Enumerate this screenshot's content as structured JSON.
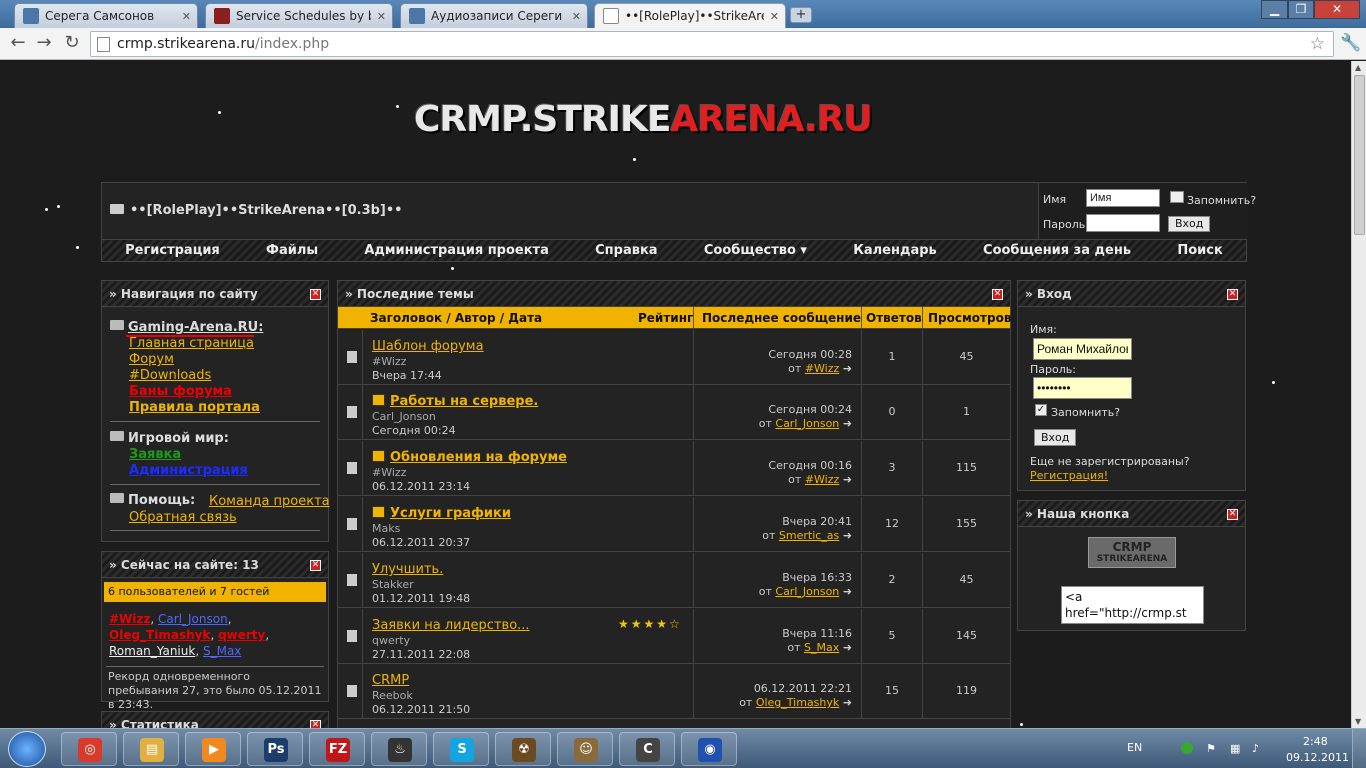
{
  "browser": {
    "tabs": [
      {
        "title": "Серега Самсонов",
        "icon": "vk-icon",
        "color": "#4a76a8"
      },
      {
        "title": "Service Schedules by break",
        "icon": "sa-icon",
        "color": "#8a2020"
      },
      {
        "title": "Аудиозаписи Сереги Самс",
        "icon": "vk-icon",
        "color": "#4a76a8"
      },
      {
        "title": "••[RolePlay]••StrikeArena••[",
        "icon": "page-icon",
        "color": "#ffffff"
      }
    ],
    "url_host": "crmp.strikearena.ru",
    "url_path": "/index.php"
  },
  "site": {
    "logo_main": "CRMP.STRIKE",
    "logo_red": "ARENA",
    "logo_end": ".RU",
    "title": "••[RolePlay]••StrikeArena••[0.3b]••",
    "header_login": {
      "name_label": "Имя",
      "name_value": "Имя",
      "remember": "Запомнить?",
      "pass_label": "Пароль",
      "login_btn": "Вход"
    },
    "menu": [
      "Регистрация",
      "Файлы",
      "Администрация проекта",
      "Справка",
      "Сообщество ▾",
      "Календарь",
      "Сообщения за день",
      "Поиск"
    ]
  },
  "nav": {
    "title": "» Навигация по сайту",
    "site_name": "Gaming-Arena.RU:",
    "links": [
      "Главная страница",
      "Форум",
      "#Downloads"
    ],
    "bans": "Баны форума",
    "rules": "Правила портала",
    "game_world": "Игровой мир:",
    "apply": "Заявка",
    "admin": "Администрация",
    "help": "Помощь:",
    "team": "Команда проекта",
    "feedback": "Обратная связь"
  },
  "online": {
    "title": "» Сейчас на сайте: 13",
    "bar": "6 пользователей и 7 гостей",
    "users_line1": [
      "#Wizz",
      "Carl_Jonson"
    ],
    "users_line2": [
      "Oleg_Timashyk",
      "qwerty"
    ],
    "users_line3": [
      "Roman_Yaniuk",
      "S_Max"
    ],
    "record": "Рекорд одновременного пребывания 27, это было 05.12.2011 в 23:43."
  },
  "stats": {
    "title": "» Статистика"
  },
  "topics": {
    "title": "» Последние темы",
    "headers": {
      "title": "Заголовок / Автор / Дата",
      "rating": "Рейтинг",
      "last": "Последнее сообщение",
      "replies": "Ответов",
      "views": "Просмотров"
    },
    "rows": [
      {
        "icon": "chart-icon",
        "title": "Шаблон форума",
        "bold": false,
        "hot": false,
        "author": "#Wizz",
        "date_day": "Вчера",
        "date_time": "17:44",
        "lp_day": "Сегодня",
        "lp_time": "00:28",
        "lp_from": "от",
        "lp_user": "#Wizz",
        "replies": "1",
        "views": "45",
        "stars": ""
      },
      {
        "icon": "bulb-icon",
        "title": "Работы на сервере.",
        "bold": true,
        "hot": true,
        "author": "Carl_Jonson",
        "date_day": "Сегодня",
        "date_time": "00:24",
        "lp_day": "Сегодня",
        "lp_time": "00:24",
        "lp_from": "от",
        "lp_user": "Carl_Jonson",
        "replies": "0",
        "views": "1",
        "stars": ""
      },
      {
        "icon": "doc-icon",
        "title": "Обновления на форуме",
        "bold": true,
        "hot": true,
        "author": "#Wizz",
        "date_day": "06.12.2011",
        "date_time": "23:14",
        "lp_day": "Сегодня",
        "lp_time": "00:16",
        "lp_from": "от",
        "lp_user": "#Wizz",
        "replies": "3",
        "views": "115",
        "stars": ""
      },
      {
        "icon": "doc-icon",
        "title": "Услуги графики",
        "bold": true,
        "hot": true,
        "author": "Maks",
        "date_day": "06.12.2011",
        "date_time": "20:37",
        "lp_day": "Вчера",
        "lp_time": "20:41",
        "lp_from": "от",
        "lp_user": "Smertic_as",
        "replies": "12",
        "views": "155",
        "stars": ""
      },
      {
        "icon": "bulb-icon",
        "title": "Улучшить.",
        "bold": false,
        "hot": false,
        "author": "Stakker",
        "date_day": "01.12.2011",
        "date_time": "19:48",
        "lp_day": "Вчера",
        "lp_time": "16:33",
        "lp_from": "от",
        "lp_user": "Carl_Jonson",
        "replies": "2",
        "views": "45",
        "stars": ""
      },
      {
        "icon": "doc-icon",
        "title": "Заявки на лидерство...",
        "bold": false,
        "hot": false,
        "author": "qwerty",
        "date_day": "27.11.2011",
        "date_time": "22:08",
        "lp_day": "Вчера",
        "lp_time": "11:16",
        "lp_from": "от",
        "lp_user": "S_Max",
        "replies": "5",
        "views": "145",
        "stars": "★★★★☆"
      },
      {
        "icon": "doc-icon",
        "title": "CRMP",
        "bold": false,
        "hot": false,
        "author": "Reebok",
        "date_day": "06.12.2011",
        "date_time": "21:50",
        "lp_day": "06.12.2011",
        "lp_time": "22:21",
        "lp_from": "от",
        "lp_user": "Oleg_Timashyk",
        "replies": "15",
        "views": "119",
        "stars": ""
      }
    ]
  },
  "login": {
    "title": "» Вход",
    "name_label": "Имя:",
    "name_value": "Роман Михайлов",
    "pass_label": "Пароль:",
    "pass_value": "••••••••",
    "remember": "Запомнить?",
    "btn": "Вход",
    "not_registered": "Еще не зарегистрированы?",
    "register": "Регистрация!"
  },
  "button_block": {
    "title": "» Наша кнопка",
    "banner_top": "CRMP",
    "banner_bottom": "STRIKEARENA",
    "code_line1": "<a",
    "code_line2": "href=\"http://crmp.st"
  },
  "taskbar": {
    "lang": "EN",
    "time": "2:48",
    "date": "09.12.2011",
    "apps": [
      {
        "name": "chrome-icon",
        "label": "◎",
        "color": "#d93b2b"
      },
      {
        "name": "explorer-icon",
        "label": "▤",
        "color": "#e0b040"
      },
      {
        "name": "media-icon",
        "label": "▶",
        "color": "#f08a20"
      },
      {
        "name": "photoshop-icon",
        "label": "Ps",
        "color": "#1c3c6c"
      },
      {
        "name": "filezilla-icon",
        "label": "FZ",
        "color": "#c01818"
      },
      {
        "name": "steam-icon",
        "label": "♨",
        "color": "#333333"
      },
      {
        "name": "skype-icon",
        "label": "S",
        "color": "#14a4e0"
      },
      {
        "name": "radiation-icon",
        "label": "☢",
        "color": "#6a4a20"
      },
      {
        "name": "game-icon",
        "label": "☺",
        "color": "#8a6a3a"
      },
      {
        "name": "counterstrike-icon",
        "label": "C",
        "color": "#444444"
      },
      {
        "name": "globe-icon",
        "label": "◉",
        "color": "#2050b0"
      }
    ]
  }
}
